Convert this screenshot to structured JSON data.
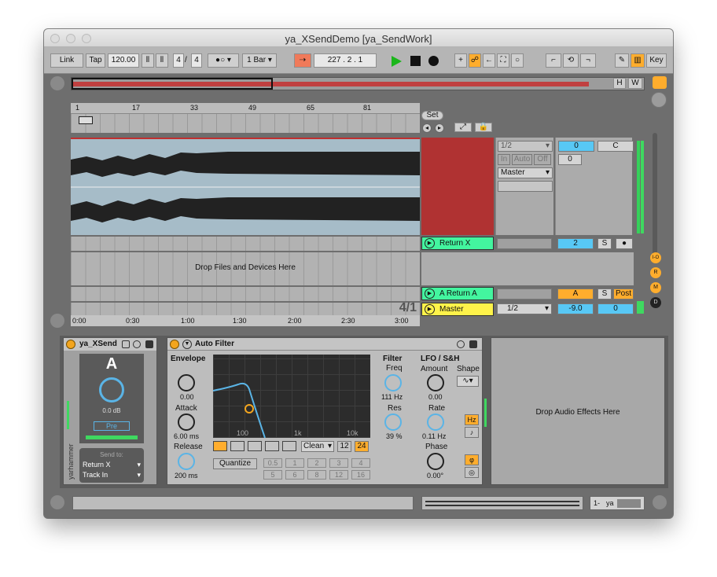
{
  "window": {
    "title": "ya_XSendDemo  [ya_SendWork]"
  },
  "control_bar": {
    "link": "Link",
    "tap": "Tap",
    "tempo": "120.00",
    "sig_num": "4",
    "sig_sep": "/",
    "sig_den": "4",
    "quant": "1 Bar",
    "position": "227 .  2 .  1",
    "key": "Key"
  },
  "overview": {
    "h": "H",
    "w": "W"
  },
  "ruler": {
    "marks": [
      "1",
      "17",
      "33",
      "49",
      "65",
      "81"
    ]
  },
  "arrangement": {
    "drop_text": "Drop Files and Devices Here",
    "loop_marker": "4/1",
    "time_marks": [
      "0:00",
      "0:30",
      "1:00",
      "1:30",
      "2:00",
      "2:30",
      "3:00"
    ],
    "set_label": "Set"
  },
  "track1": {
    "input": "1/2",
    "monitor": [
      "In",
      "Auto",
      "Off"
    ],
    "output": "Master",
    "volume": "0",
    "pan": "C",
    "send": "0"
  },
  "return_x": {
    "name": "Return X",
    "number": "2",
    "solo": "S"
  },
  "return_a": {
    "name": "A Return A",
    "letter": "A",
    "solo": "S",
    "post": "Post"
  },
  "master": {
    "name": "Master",
    "output": "1/2",
    "volume": "-9.0",
    "pan": "0"
  },
  "side_buttons": [
    "I-O",
    "R",
    "M",
    "D"
  ],
  "device1": {
    "title": "ya_XSend",
    "letter": "A",
    "gain": "0.0 dB",
    "pre": "Pre",
    "brand": "yarhammer",
    "send_to": "Send to:",
    "send_target": "Return X",
    "track_target": "Track In"
  },
  "device2": {
    "title": "Auto Filter",
    "envelope": "Envelope",
    "env_val": "0.00",
    "attack": "Attack",
    "attack_val": "6.00 ms",
    "release": "Release",
    "release_val": "200 ms",
    "freq_labels": [
      "100",
      "1k",
      "10k"
    ],
    "filter": "Filter",
    "freq": "Freq",
    "freq_val": "111 Hz",
    "res": "Res",
    "res_val": "39 %",
    "lfo": "LFO / S&H",
    "amount": "Amount",
    "amount_val": "0.00",
    "shape": "Shape",
    "rate": "Rate",
    "rate_val": "0.11 Hz",
    "hz": "Hz",
    "phase": "Phase",
    "phase_val": "0.00°",
    "clean": "Clean",
    "slope12": "12",
    "slope24": "24",
    "quantize": "Quantize",
    "quant_row1": [
      "0.5",
      "1",
      "2",
      "3",
      "4"
    ],
    "quant_row2": [
      "5",
      "6",
      "8",
      "12",
      "16"
    ]
  },
  "drop_effects": "Drop Audio Effects Here",
  "status": {
    "track": "1-",
    "clip": "ya"
  },
  "colors": {
    "red_clip": "#b03232",
    "return_green": "#43f59f",
    "master_yellow": "#fff34a",
    "blue_value": "#58c8f5",
    "orange": "#ffad2d"
  }
}
